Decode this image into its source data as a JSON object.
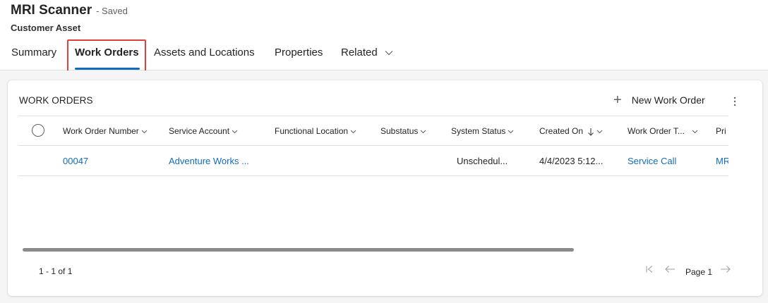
{
  "header": {
    "title": "MRI Scanner",
    "saved_status": "- Saved",
    "subtitle": "Customer Asset",
    "tabs": [
      {
        "label": "Summary"
      },
      {
        "label": "Work Orders"
      },
      {
        "label": "Assets and Locations"
      },
      {
        "label": "Properties"
      },
      {
        "label": "Related"
      }
    ],
    "active_tab": "Work Orders"
  },
  "work_orders": {
    "title": "WORK ORDERS",
    "new_button": "New Work Order",
    "columns": [
      "Work Order Number",
      "Service Account",
      "Functional Location",
      "Substatus",
      "System Status",
      "Created On",
      "Work Order T...",
      "Pri"
    ],
    "rows": [
      {
        "work_order_number": "00047",
        "service_account": "Adventure Works ...",
        "functional_location": "",
        "substatus": "",
        "system_status": "Unschedul...",
        "created_on": "4/4/2023 5:12...",
        "work_order_type": "Service Call",
        "primary": "MR"
      }
    ],
    "footer": {
      "count": "1 - 1 of 1",
      "page": "Page 1"
    }
  },
  "colors": {
    "accent": "#0f6cbd",
    "highlight": "#e0403d",
    "text": "#242424",
    "muted": "#616161",
    "background": "#f5f5f5"
  },
  "icons": [
    "chevron-down-icon",
    "plus-icon",
    "more-vertical-icon",
    "sort-descending-icon",
    "first-page-icon",
    "previous-page-icon",
    "next-page-icon"
  ]
}
